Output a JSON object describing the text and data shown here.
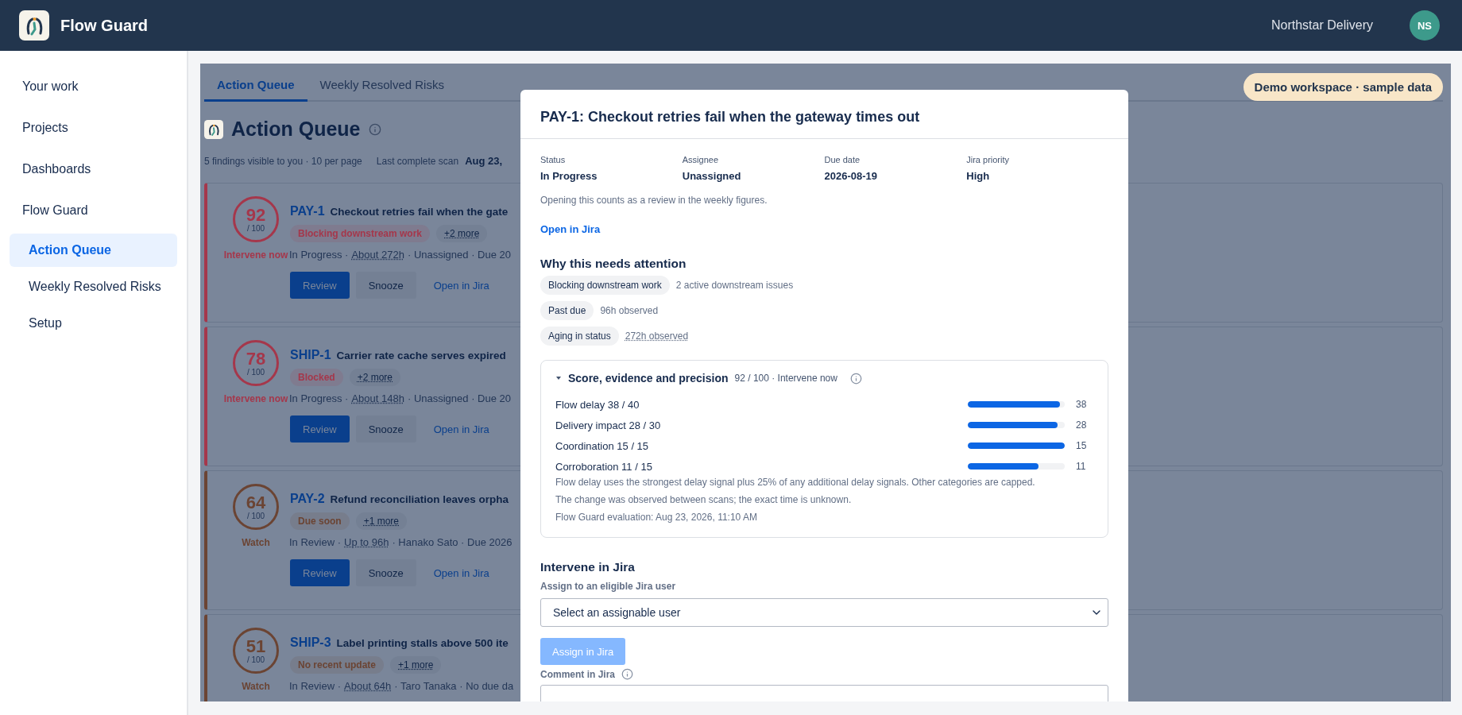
{
  "topbar": {
    "app_name": "Flow Guard",
    "workspace": "Northstar Delivery",
    "avatar": "NS"
  },
  "sidebar": {
    "items": [
      {
        "label": "Your work",
        "selected": false
      },
      {
        "label": "Projects",
        "selected": false
      },
      {
        "label": "Dashboards",
        "selected": false
      },
      {
        "label": "Flow Guard",
        "selected": false,
        "children": [
          {
            "label": "Action Queue",
            "selected": true
          },
          {
            "label": "Weekly Resolved Risks",
            "selected": false
          },
          {
            "label": "Setup",
            "selected": false
          }
        ]
      }
    ]
  },
  "main": {
    "tabs": [
      {
        "label": "Action Queue",
        "selected": true
      },
      {
        "label": "Weekly Resolved Risks",
        "selected": false
      }
    ],
    "badge": "Demo workspace · sample data",
    "heading": "Action Queue",
    "summary": "5 findings visible to you · 10 per page",
    "scan_label": "Last complete scan",
    "scan_value": "Aug 23,",
    "findings": [
      {
        "score": "92",
        "out_of": "/ 100",
        "verdict": "Intervene now",
        "color": "#a5374b",
        "key": "PAY-1",
        "title": "Checkout retries fail when the gate",
        "tag": "Blocking downstream work",
        "more": "+2 more",
        "meta_before": "In Progress ·",
        "age": "About 272h",
        "meta_after": "· Unassigned · Due 20",
        "actions": [
          "Review",
          "Snooze",
          "Open in Jira"
        ]
      },
      {
        "score": "78",
        "out_of": "/ 100",
        "verdict": "Intervene now",
        "color": "#a5374b",
        "key": "SHIP-1",
        "title": "Carrier rate cache serves expired",
        "tag": "Blocked",
        "more": "+2 more",
        "meta_before": "In Progress ·",
        "age": "About 148h",
        "meta_after": "· Unassigned · Due 20",
        "actions": [
          "Review",
          "Snooze",
          "Open in Jira"
        ]
      },
      {
        "score": "64",
        "out_of": "/ 100",
        "verdict": "Watch",
        "color": "#6b4433",
        "key": "PAY-2",
        "title": "Refund reconciliation leaves orpha",
        "tag": "Due soon",
        "more": "+1 more",
        "meta_before": "In Review ·",
        "age": "Up to 96h",
        "meta_after": "· Hanako Sato · Due 2026",
        "actions": [
          "Review",
          "Snooze",
          "Open in Jira"
        ]
      },
      {
        "score": "51",
        "out_of": "/ 100",
        "verdict": "Watch",
        "color": "#6b4433",
        "key": "SHIP-3",
        "title": "Label printing stalls above 500 ite",
        "tag": "No recent update",
        "more": "+1 more",
        "meta_before": "In Review ·",
        "age": "About 64h",
        "meta_after": "· Taro Tanaka · No due da"
      }
    ]
  },
  "modal": {
    "title": "PAY-1: Checkout retries fail when the gateway times out",
    "fields": [
      {
        "label": "Status",
        "value": "In Progress"
      },
      {
        "label": "Assignee",
        "value": "Unassigned"
      },
      {
        "label": "Due date",
        "value": "2026-08-19"
      },
      {
        "label": "Jira priority",
        "value": "High"
      }
    ],
    "note": "Opening this counts as a review in the weekly figures.",
    "link": "Open in Jira",
    "why_heading": "Why this needs attention",
    "reasons": [
      {
        "tag": "Blocking downstream work",
        "detail": "2 active downstream issues",
        "underlined": false
      },
      {
        "tag": "Past due",
        "detail": "96h observed",
        "underlined": false
      },
      {
        "tag": "Aging in status",
        "detail": "272h observed",
        "underlined": true
      }
    ],
    "score_section": {
      "expanded": true,
      "title": "Score, evidence and precision",
      "summary": "92 / 100 · Intervene now",
      "components": [
        {
          "label": "Flow delay 38 / 40",
          "level": 0.95,
          "value": "38"
        },
        {
          "label": "Delivery impact 28 / 30",
          "level": 0.93,
          "value": "28"
        },
        {
          "label": "Coordination 15 / 15",
          "level": 1,
          "value": "15"
        },
        {
          "label": "Corroboration 11 / 15",
          "level": 0.73,
          "value": "11"
        }
      ],
      "notes": [
        "Flow delay uses the strongest delay signal plus 25% of any additional delay signals. Other categories are capped.",
        "The change was observed between scans; the exact time is unknown.",
        "Flow Guard evaluation: Aug 23, 2026, 11:10 AM"
      ]
    },
    "intervene": {
      "heading": "Intervene in Jira",
      "assign_label": "Assign to an eligible Jira user",
      "select_value": "Select an assignable user",
      "assign_button": {
        "label": "Assign in Jira",
        "disabled": true
      },
      "comment_label": "Comment in Jira"
    }
  }
}
